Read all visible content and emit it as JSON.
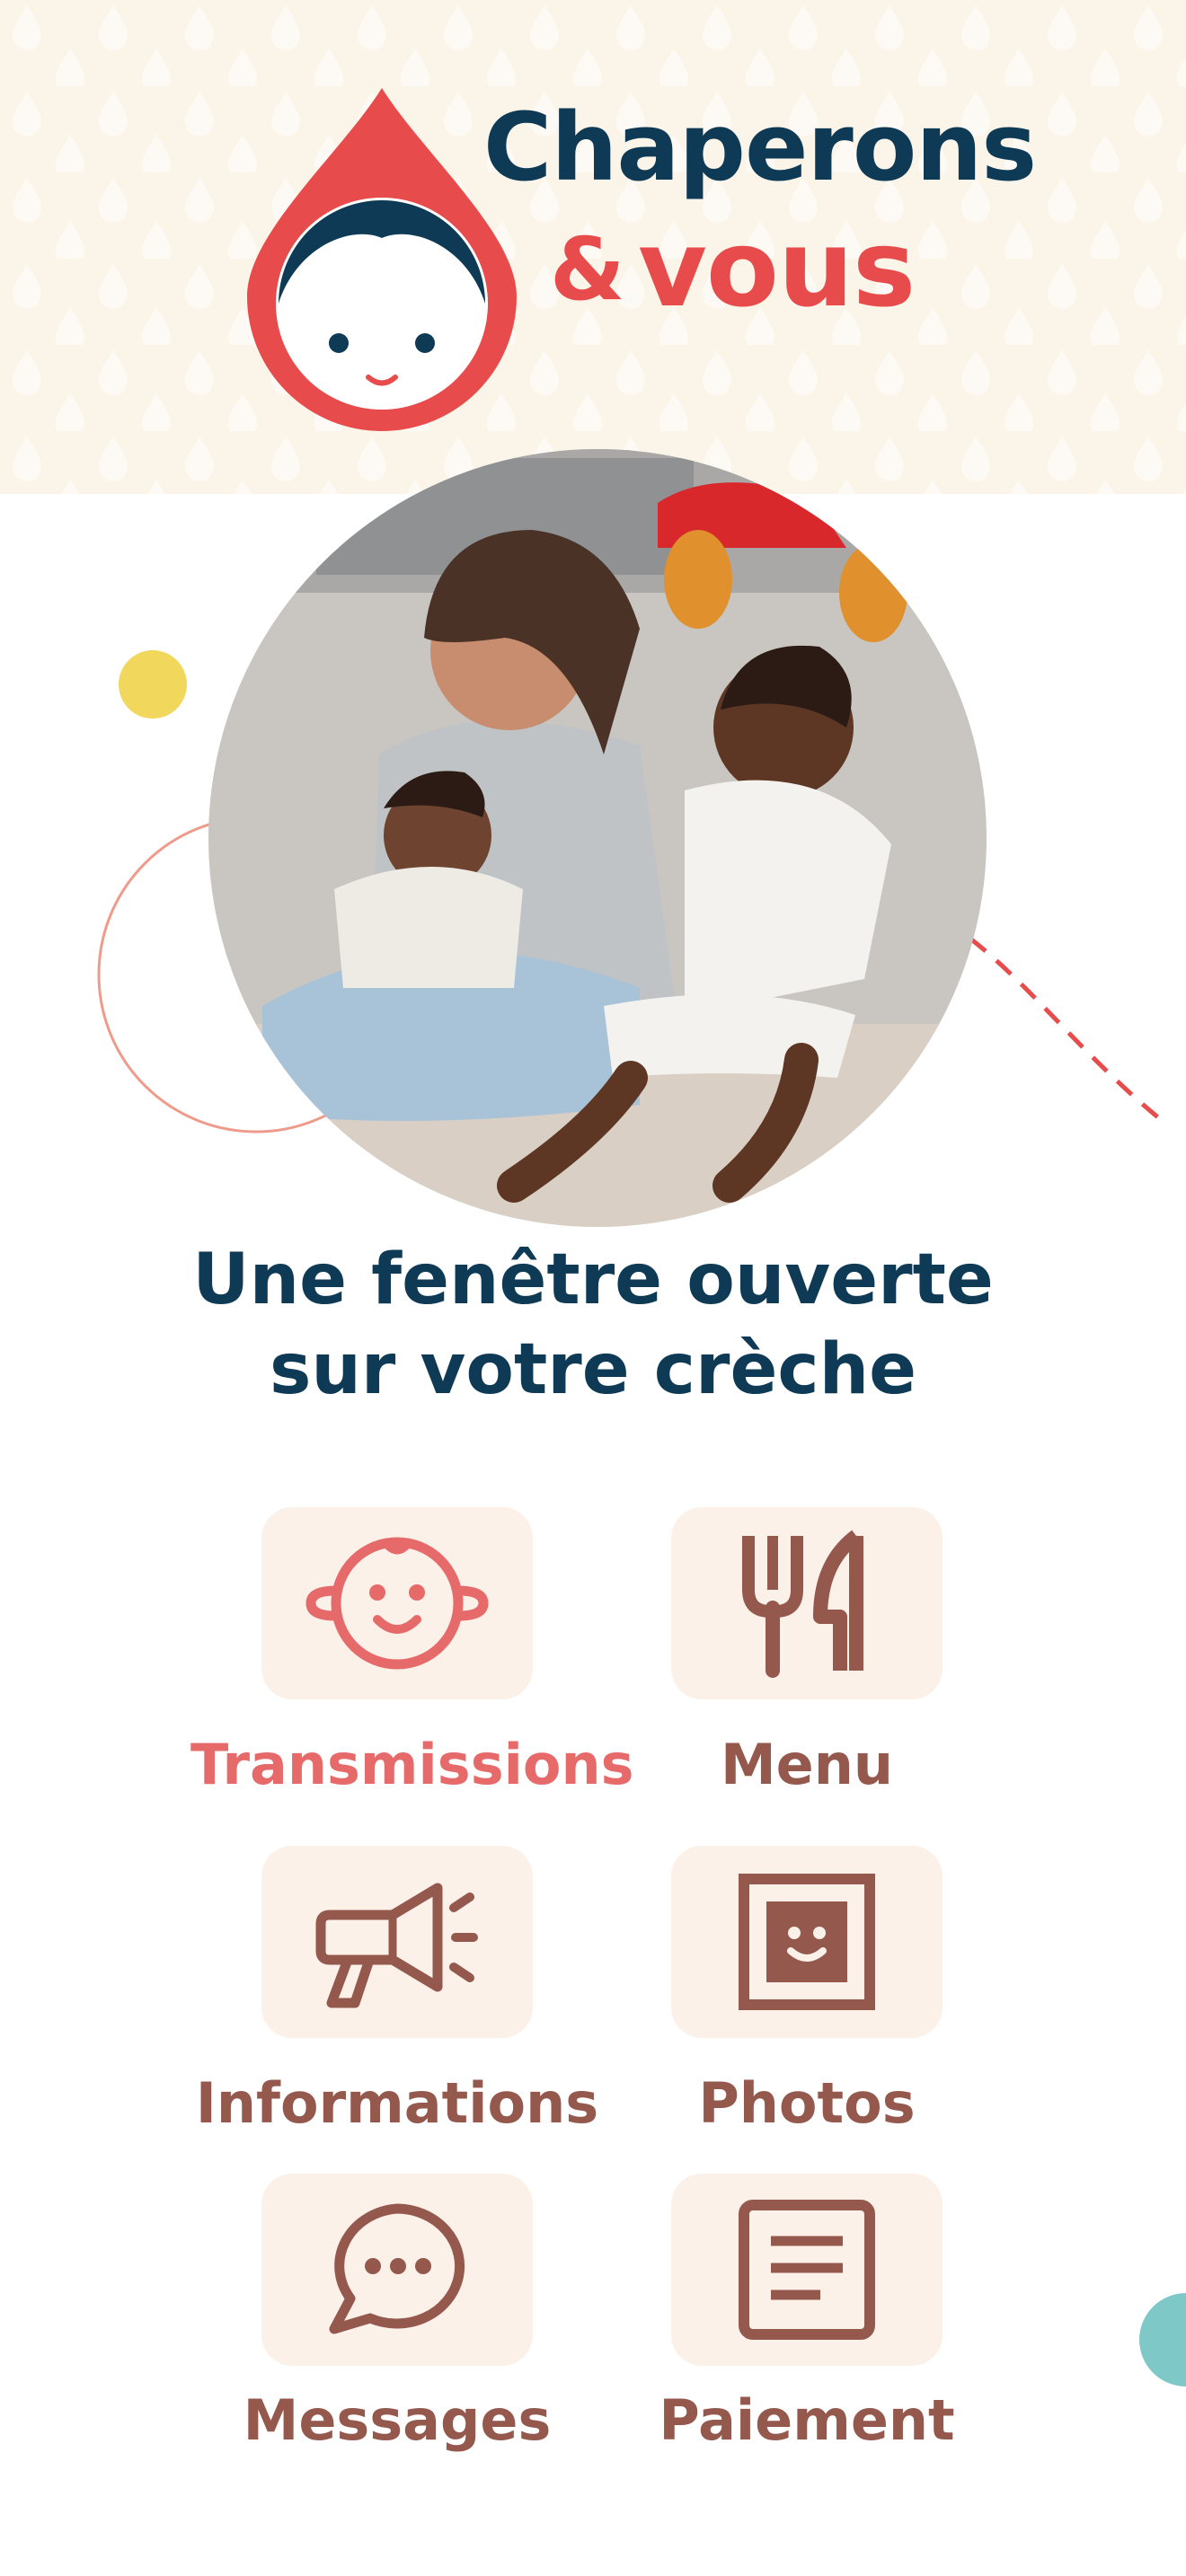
{
  "brand": {
    "name_line1": "Chaperons",
    "name_amp": "&",
    "name_line2": "vous",
    "colors": {
      "navy": "#0e3a56",
      "red": "#e84b4b",
      "brown": "#94584d",
      "pink": "#e76a6a",
      "cream": "#fbf4e8"
    }
  },
  "hero": {
    "image": "photo of a caregiver sitting on the floor with two young children",
    "title_line1": "Une fenêtre ouverte",
    "title_line2": "sur votre crèche"
  },
  "menu": {
    "items": [
      {
        "label": "Transmissions",
        "icon": "baby-face-icon",
        "active": true
      },
      {
        "label": "Menu",
        "icon": "fork-knife-icon",
        "active": false
      },
      {
        "label": "Informations",
        "icon": "megaphone-icon",
        "active": false
      },
      {
        "label": "Photos",
        "icon": "photo-frame-icon",
        "active": false
      },
      {
        "label": "Messages",
        "icon": "chat-bubble-icon",
        "active": false
      },
      {
        "label": "Paiement",
        "icon": "invoice-icon",
        "active": false
      }
    ]
  }
}
